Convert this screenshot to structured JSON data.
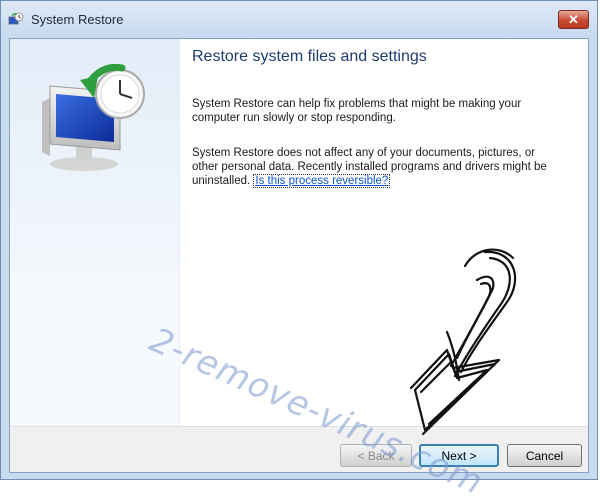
{
  "window": {
    "title": "System Restore",
    "close_label": "✕"
  },
  "content": {
    "heading": "Restore system files and settings",
    "paragraph1": "System Restore can help fix problems that might be making your computer run slowly or stop responding.",
    "paragraph2": "System Restore does not affect any of your documents, pictures, or other personal data. Recently installed programs and drivers might be uninstalled.",
    "link": "Is this process reversible?"
  },
  "buttons": {
    "back": "< Back",
    "next": "Next >",
    "cancel": "Cancel"
  },
  "overlay": {
    "watermark": "2-remove-virus.com"
  },
  "icons": {
    "title": "system-restore-icon",
    "illustration": "monitor-clock-restore-icon",
    "annotation": "hand-drawn-arrow-icon"
  },
  "colors": {
    "title_bar": "#c6d9ee",
    "heading": "#1e3c6e",
    "link": "#0b57c8",
    "close_button": "#c94a31",
    "watermark": "#7896cd"
  }
}
